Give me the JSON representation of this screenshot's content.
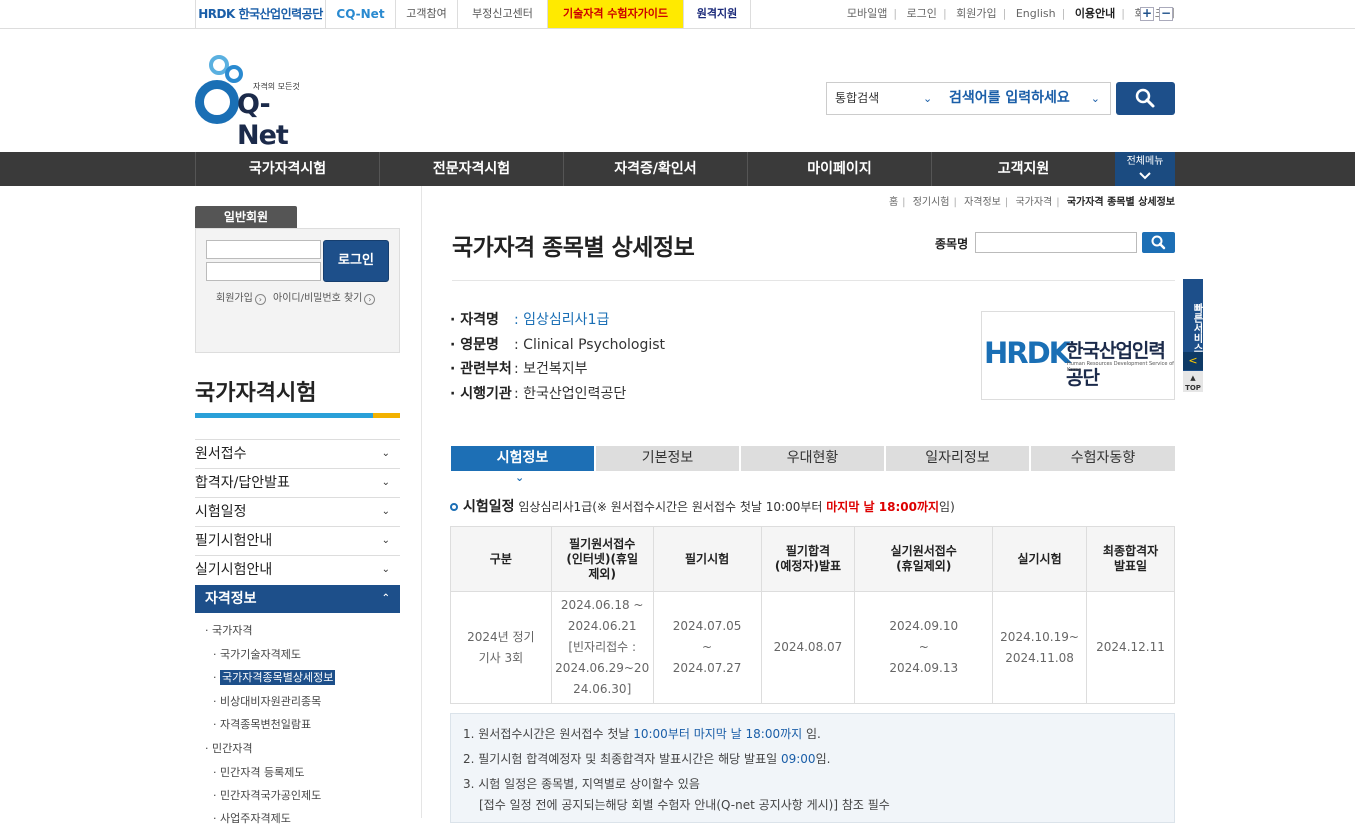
{
  "topbar": {
    "logo_hrdk": "HRDK 한국산업인력공단",
    "logo_cq": "CQ-Net",
    "links": [
      "고객참여",
      "부정신고센터",
      "기술자격 수험자가이드",
      "원격지원"
    ],
    "right_links": [
      "모바일앱",
      "로그인",
      "회원가입",
      "English",
      "이용안내",
      "화면크기"
    ],
    "zoom_in": "+",
    "zoom_out": "−"
  },
  "header": {
    "logo_text": "Q-Net",
    "logo_tagline": "자격의 모든것",
    "search_scope": "통합검색",
    "search_placeholder": "검색어를 입력하세요"
  },
  "gnb": {
    "items": [
      "국가자격시험",
      "전문자격시험",
      "자격증/확인서",
      "마이페이지",
      "고객지원"
    ],
    "all_menu": "전체메뉴"
  },
  "login": {
    "tab": "일반회원",
    "button": "로그인",
    "join": "회원가입",
    "find": "아이디/비밀번호 찾기"
  },
  "lnb": {
    "title": "국가자격시험",
    "items": [
      "원서접수",
      "합격자/답안발표",
      "시험일정",
      "필기시험안내",
      "실기시험안내",
      "자격정보"
    ],
    "sub": [
      "국가자격",
      "국가기술자격제도",
      "국가자격종목별상세정보",
      "비상대비자원관리종목",
      "자격종목변천일람표",
      "민간자격",
      "민간자격 등록제도",
      "민간자격국가공인제도",
      "사업주자격제도"
    ]
  },
  "breadcrumb": [
    "홈",
    "정기시험",
    "자격정보",
    "국가자격",
    "국가자격 종목별 상세정보"
  ],
  "page": {
    "title": "국가자격 종목별 상세정보",
    "search_label": "종목명"
  },
  "info": {
    "labels": [
      "· 자격명",
      "· 영문명",
      "· 관련부처",
      "· 시행기관"
    ],
    "values": [
      ": 임상심리사1급",
      ": Clinical Psychologist",
      ": 보건복지부",
      ": 한국산업인력공단"
    ],
    "org_logo": "HRDK",
    "org_name": "한국산업인력공단",
    "org_name_en": "Human Resources Development Service of Korea"
  },
  "quick": {
    "label": "빠른서비스",
    "arrow": "<",
    "top": "TOP"
  },
  "tabs": [
    "시험정보",
    "기본정보",
    "우대현황",
    "일자리정보",
    "수험자동향"
  ],
  "schedule": {
    "heading": "시험일정",
    "subject": "임상심리사1급",
    "note_pre": "(※ 원서접수시간은 원서접수 첫날 10:00부터 ",
    "note_red": "마지막 날 18:00까지",
    "note_post": "임)",
    "headers": [
      "구분",
      "필기원서접수\n(인터넷)(휴일\n제외)",
      "필기시험",
      "필기합격\n(예정자)발표",
      "실기원서접수\n(휴일제외)",
      "실기시험",
      "최종합격자\n발표일"
    ],
    "row": [
      "2024년 정기\n기사 3회",
      "2024.06.18 ~\n2024.06.21\n[빈자리접수 :\n2024.06.29~20\n24.06.30]",
      "2024.07.05\n~\n2024.07.27",
      "2024.08.07",
      "2024.09.10\n~\n2024.09.13",
      "2024.10.19~\n2024.11.08",
      "2024.12.11"
    ]
  },
  "notes": {
    "n1_pre": "1. 원서접수시간은 원서접수 첫날 ",
    "n1_blue": "10:00부터 마지막 날 18:00까지",
    "n1_post": " 임.",
    "n2_pre": "2. 필기시험 합격예정자 및 최종합격자 발표시간은 해당 발표일 ",
    "n2_blue": "09:00",
    "n2_post": "임.",
    "n3": "3. 시험 일정은 종목별, 지역별로 상이할수 있음",
    "n3b": "[접수 일정 전에 공지되는해당 회별 수험자 안내(Q-net 공지사항 게시)] 참조 필수"
  }
}
